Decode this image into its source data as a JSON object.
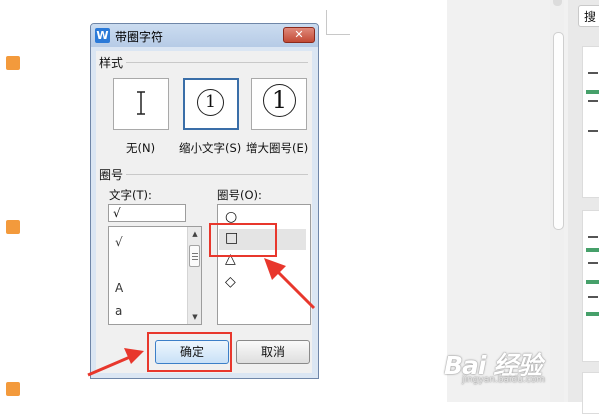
{
  "dialog": {
    "title": "带圈字符",
    "close_glyph": "✕",
    "app_icon_letter": "W",
    "style_group": {
      "label": "样式",
      "options": [
        {
          "caption": "无(N)",
          "symbol": ""
        },
        {
          "caption": "缩小文字(S)",
          "symbol": "1"
        },
        {
          "caption": "增大圈号(E)",
          "symbol": "1"
        }
      ],
      "selected": "缩小文字(S)"
    },
    "enclosure_group": {
      "label": "圈号",
      "text_label": "文字(T):",
      "text_value": "√",
      "text_list": [
        "√",
        "A",
        "a"
      ],
      "enclosure_label": "圈号(O):",
      "enclosures": [
        "○",
        "□",
        "△",
        "◇"
      ],
      "selected_enclosure": "□"
    },
    "ok_label": "确定",
    "cancel_label": "取消"
  },
  "sidebar": {
    "search_label": "搜"
  },
  "watermark": {
    "main": "Bai  经验",
    "sub": "jingyan.baidu.com"
  },
  "colors": {
    "highlight": "#e8372c",
    "arrow": "#e8372c",
    "selected_border": "#3a6ea8"
  }
}
